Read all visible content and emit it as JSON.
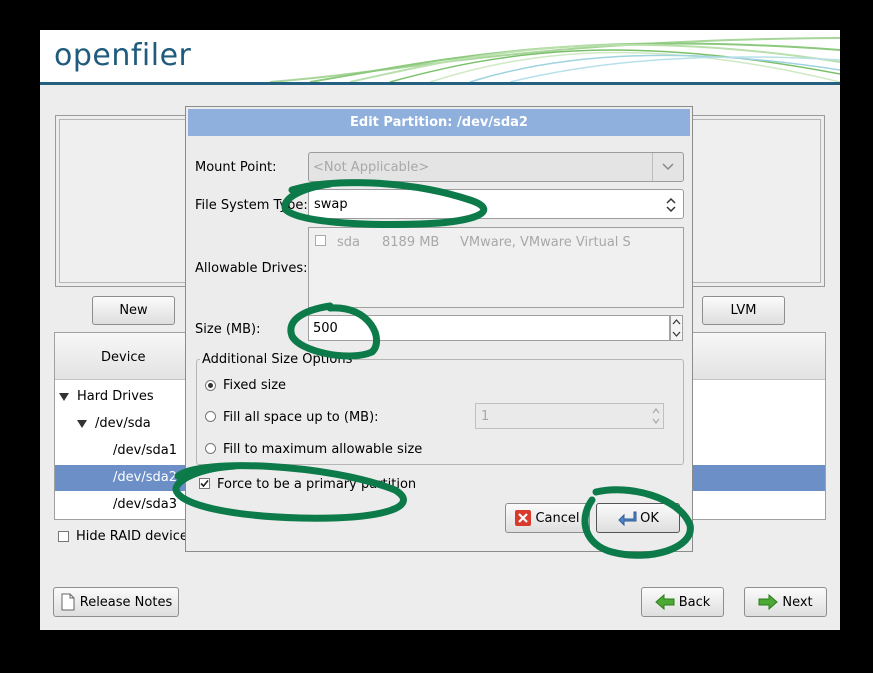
{
  "app": {
    "logo_text": "openfiler"
  },
  "main": {
    "new_button": "New",
    "lvm_button": "LVM",
    "tree": {
      "column_header": "Device",
      "rows": [
        {
          "label": "Hard Drives"
        },
        {
          "label": "/dev/sda"
        },
        {
          "label": "/dev/sda1"
        },
        {
          "label": "/dev/sda2"
        },
        {
          "label": "/dev/sda3"
        }
      ]
    },
    "hide_raid_label": "Hide RAID device/"
  },
  "footer": {
    "release_notes": "Release Notes",
    "back": "Back",
    "next": "Next"
  },
  "dialog": {
    "title": "Edit Partition: /dev/sda2",
    "mount_point_label": "Mount Point:",
    "mount_point_value": "<Not Applicable>",
    "fs_type_label": "File System Type:",
    "fs_type_value": "swap",
    "allowable_drives_label": "Allowable Drives:",
    "drive": {
      "name": "sda",
      "size": "8189 MB",
      "model": "VMware, VMware Virtual S"
    },
    "size_label": "Size (MB):",
    "size_value": "500",
    "additional_size_title": "Additional Size Options",
    "option_fixed": "Fixed size",
    "option_fill_up_to": "Fill all space up to (MB):",
    "fill_up_to_value": "1",
    "option_fill_max": "Fill to maximum allowable size",
    "force_primary_label": "Force to be a primary partition",
    "cancel": "Cancel",
    "ok": "OK"
  },
  "colors": {
    "selection": "#6c8fc7",
    "dialog_title_bg": "#8fb0dc",
    "annotation": "#0d7a4a",
    "logo": "#1f5b7c"
  }
}
